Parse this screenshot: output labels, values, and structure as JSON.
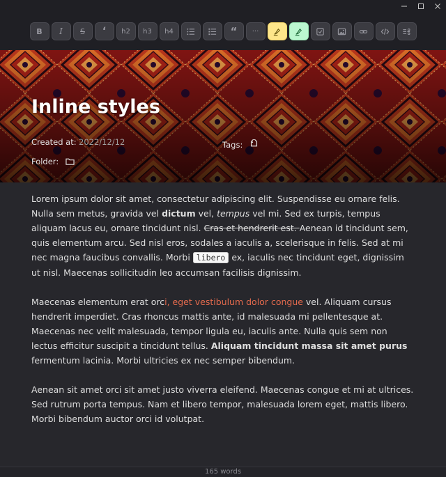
{
  "window": {
    "minimize_glyph": "—",
    "maximize_glyph": "□",
    "close_glyph": "✕"
  },
  "toolbar": {
    "buttons": [
      {
        "label": "B",
        "icon": "bold-icon"
      },
      {
        "label": "I",
        "icon": "italic-icon"
      },
      {
        "label": "S",
        "icon": "strikethrough-icon"
      },
      {
        "label": "‘",
        "icon": "inline-quote-icon"
      },
      {
        "label": "h2",
        "icon": "heading-2-icon"
      },
      {
        "label": "h3",
        "icon": "heading-3-icon"
      },
      {
        "label": "h4",
        "icon": "heading-4-icon"
      },
      {
        "label": "",
        "icon": "bulleted-list-icon"
      },
      {
        "label": "",
        "icon": "numbered-list-icon"
      },
      {
        "label": "“",
        "icon": "blockquote-icon"
      },
      {
        "label": "···",
        "icon": "more-icon"
      },
      {
        "label": "",
        "icon": "highlighter-yellow-icon"
      },
      {
        "label": "",
        "icon": "highlighter-green-icon"
      },
      {
        "label": "",
        "icon": "checkbox-icon"
      },
      {
        "label": "",
        "icon": "image-icon"
      },
      {
        "label": "",
        "icon": "link-icon"
      },
      {
        "label": "",
        "icon": "code-icon"
      },
      {
        "label": "",
        "icon": "code-block-icon"
      }
    ],
    "highlight_yellow": "#fde68a",
    "highlight_green": "#bbf7d0"
  },
  "note": {
    "title": "Inline styles",
    "created_label": "Created at:",
    "created_value": "2022/12/12",
    "tags_label": "Tags:",
    "folder_label": "Folder:"
  },
  "content": {
    "p1": {
      "a": "Lorem ipsum dolor sit amet, consectetur adipiscing elit. Suspendisse eu ornare felis. Nulla sem metus, gravida vel ",
      "bold": "dictum",
      "b": " vel, ",
      "italic": "tempus",
      "c": " vel mi. Sed ex turpis, tempus aliquam lacus eu, ornare tincidunt nisl. ",
      "strike": "Cras et hendrerit est. ",
      "d": "Aenean id tincidunt sem, quis elementum arcu. Sed nisl eros, sodales a iaculis a, scelerisque in felis. Sed at mi nec magna faucibus convallis. Morbi ",
      "code": "libero",
      "e": " ex, iaculis nec tincidunt eget, dignissim ut nisl. Maecenas sollicitudin leo accumsan facilisis dignissim."
    },
    "p2": {
      "a": "Maecenas elementum erat orc",
      "red": "i, eget vestibulum dolor congue",
      "b": " vel. Aliquam cursus hendrerit imperdiet. Cras rhoncus mattis ante, id malesuada mi pellentesque at. Maecenas nec velit malesuada, tempor ligula eu, iaculis ante. Nulla quis sem non lectus efficitur suscipit a tincidunt tellus. ",
      "bold": "Aliquam tincidunt massa sit amet purus",
      "c": " fermentum lacinia. Morbi ultricies ex nec semper bibendum."
    },
    "p3": "Aenean sit amet orci sit amet justo viverra eleifend. Maecenas congue et mi at ultrices. Sed rutrum porta tempus. Nam et libero tempor, malesuada lorem eget, mattis libero. Morbi bibendum auctor orci id volutpat.",
    "accent_red": "#e46a4d"
  },
  "status": {
    "word_count": "165 words"
  }
}
